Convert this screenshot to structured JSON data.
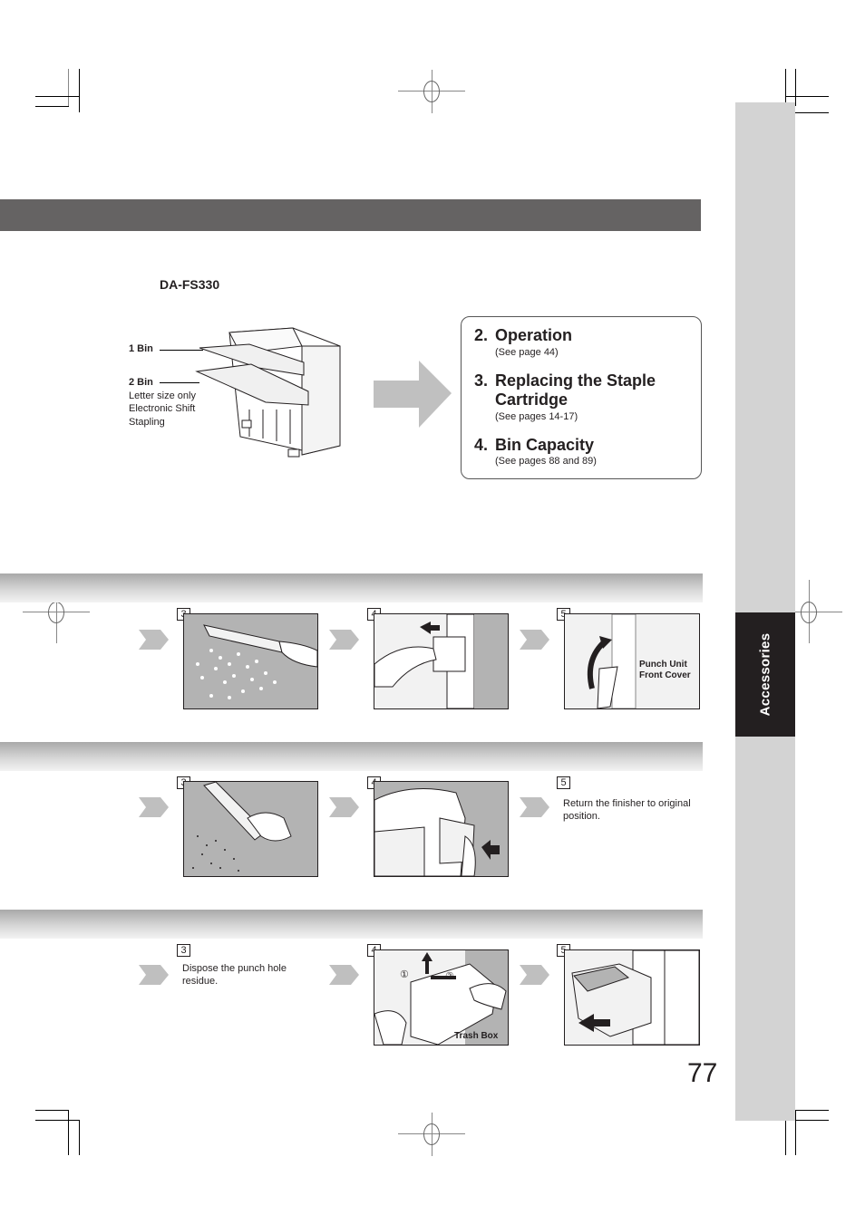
{
  "page": {
    "number": "77",
    "side_tab_label": "Accessories",
    "colors": {
      "header_bar": "#656363",
      "side_tab": "#d3d3d3",
      "side_tab_active": "#231f20",
      "illustration_bg": "#b3b3b3",
      "arrow": "#c0c0c0"
    }
  },
  "overview": {
    "model": "DA-FS330",
    "bin_labels": [
      {
        "title": "1 Bin",
        "notes": []
      },
      {
        "title": "2 Bin",
        "notes": [
          "Letter size only",
          "Electronic Shift",
          "Stapling"
        ]
      }
    ],
    "see_also": [
      {
        "num": "2.",
        "title_lines": [
          "Operation"
        ],
        "ref": "(See page 44)"
      },
      {
        "num": "3.",
        "title_lines": [
          "Replacing the Staple",
          "Cartridge"
        ],
        "ref": "(See pages 14-17)"
      },
      {
        "num": "4.",
        "title_lines": [
          "Bin Capacity"
        ],
        "ref": "(See pages 88 and 89)"
      }
    ]
  },
  "sections": [
    {
      "steps": [
        {
          "num": "3",
          "type": "image",
          "image": "shaking-punch-residue-illustration",
          "caption": ""
        },
        {
          "num": "4",
          "type": "image",
          "image": "inserting-punch-box-illustration",
          "caption": ""
        },
        {
          "num": "5",
          "type": "image",
          "image": "closing-front-cover-illustration",
          "caption": "",
          "callout_lines": [
            "Punch Unit",
            "Front Cover"
          ]
        }
      ]
    },
    {
      "steps": [
        {
          "num": "3",
          "type": "image",
          "image": "emptying-tray-illustration",
          "caption": ""
        },
        {
          "num": "4",
          "type": "image",
          "image": "pushing-finisher-illustration",
          "caption": ""
        },
        {
          "num": "5",
          "type": "text",
          "caption": "Return the finisher to original position."
        }
      ]
    },
    {
      "steps": [
        {
          "num": "3",
          "type": "text",
          "caption": "Dispose the punch hole residue."
        },
        {
          "num": "4",
          "type": "image",
          "image": "removing-trash-box-illustration",
          "caption": "",
          "callout_lines": [
            "Trash Box"
          ],
          "markers": [
            "①",
            "②"
          ]
        },
        {
          "num": "5",
          "type": "image",
          "image": "reinstalling-finisher-illustration",
          "caption": ""
        }
      ]
    }
  ]
}
